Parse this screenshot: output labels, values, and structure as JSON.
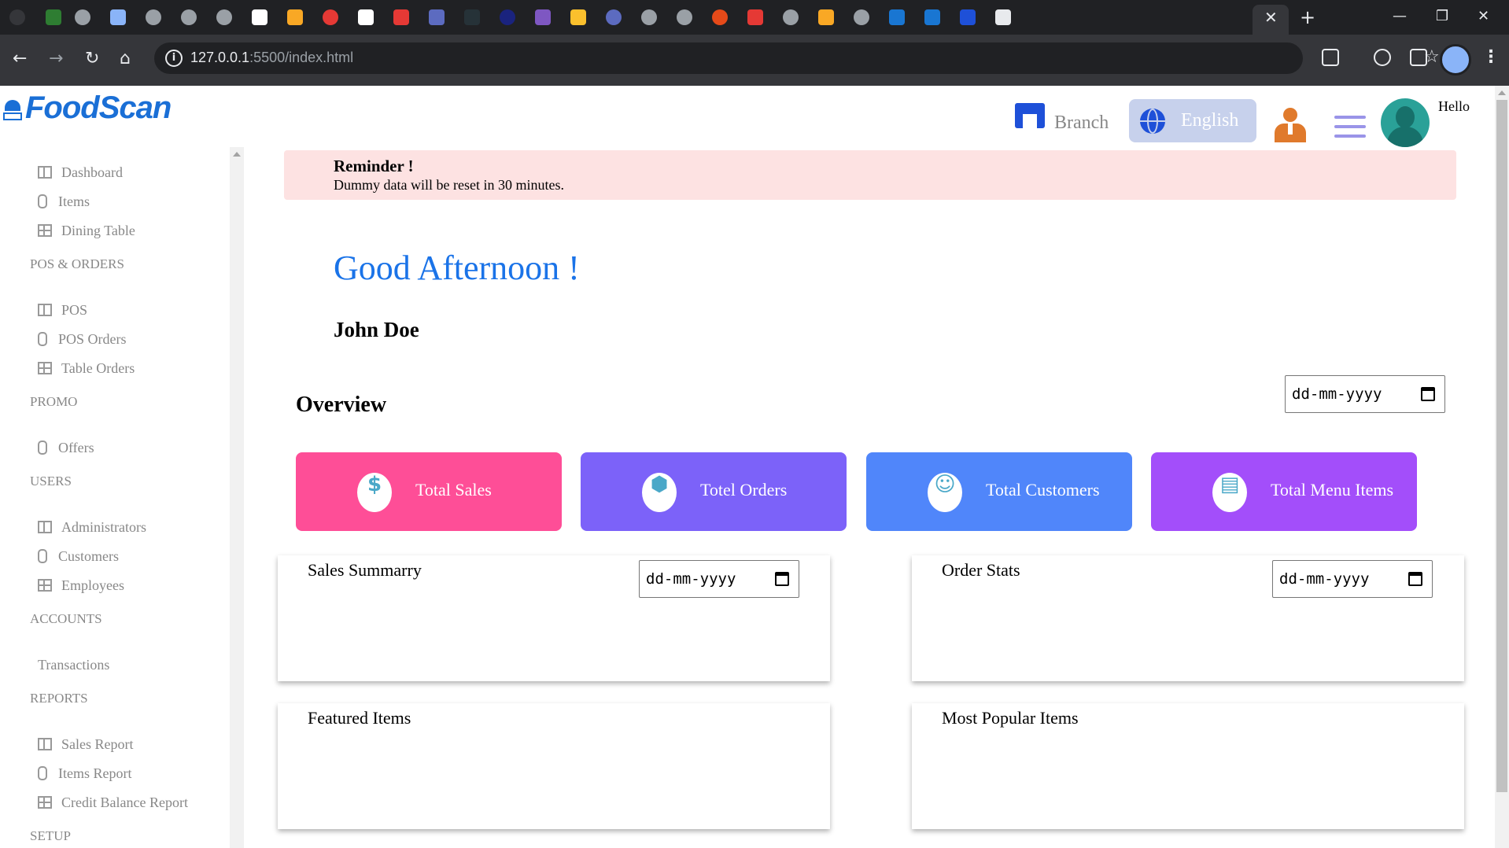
{
  "browser": {
    "tab_close": "✕",
    "new_tab": "+",
    "window_controls": [
      "—",
      "❐",
      "✕"
    ],
    "nav": {
      "back": "←",
      "forward": "→",
      "reload": "↻",
      "home": "⌂"
    },
    "url_host": "127.0.0.1",
    "url_path": ":5500/index.html",
    "bookmark_star": "☆",
    "menu": "⋮"
  },
  "app": {
    "logo_text": "FoodScan",
    "brand_color": "#1a6fd6"
  },
  "header": {
    "branch_label": "Branch",
    "language_label": "English",
    "hello_label": "Hello"
  },
  "sidebar": {
    "groups": [
      {
        "section": "",
        "items": [
          {
            "label": "Dashboard",
            "icon": "grid-icon"
          },
          {
            "label": "Items",
            "icon": "figma-icon"
          },
          {
            "label": "Dining Table",
            "icon": "table-icon"
          }
        ]
      },
      {
        "section": "POS & ORDERS",
        "items": [
          {
            "label": "POS",
            "icon": "grid-icon"
          },
          {
            "label": "POS Orders",
            "icon": "figma-icon"
          },
          {
            "label": "Table Orders",
            "icon": "table-icon"
          }
        ]
      },
      {
        "section": "PROMO",
        "items": [
          {
            "label": "Offers",
            "icon": "figma-icon"
          }
        ]
      },
      {
        "section": "USERS",
        "items": [
          {
            "label": "Administrators",
            "icon": "grid-icon"
          },
          {
            "label": "Customers",
            "icon": "figma-icon"
          },
          {
            "label": "Employees",
            "icon": "table-icon"
          }
        ]
      },
      {
        "section": "ACCOUNTS",
        "items": [
          {
            "label": "Transactions",
            "icon": "none"
          }
        ]
      },
      {
        "section": "REPORTS",
        "items": [
          {
            "label": "Sales Report",
            "icon": "grid-icon"
          },
          {
            "label": "Items Report",
            "icon": "figma-icon"
          },
          {
            "label": "Credit Balance Report",
            "icon": "table-icon"
          }
        ]
      },
      {
        "section": "SETUP",
        "items": []
      }
    ]
  },
  "reminder": {
    "title": "Reminder !",
    "text": "Dummy data will be reset in 30 minutes."
  },
  "main": {
    "greeting": "Good Afternoon !",
    "user_name": "John Doe",
    "overview_title": "Overview",
    "date_placeholder": "dd-mm-yyyy"
  },
  "stats": [
    {
      "label": "Total Sales",
      "icon": "dollar-icon",
      "glyph": "$",
      "color": "#fe4e97",
      "icon_color": "#4aa8c8"
    },
    {
      "label": "Totel Orders",
      "icon": "box-icon",
      "glyph": "⬢",
      "color": "#7c62f9",
      "icon_color": "#4aa8c8"
    },
    {
      "label": "Total Customers",
      "icon": "user-icon",
      "glyph": "☺",
      "color": "#5086fa",
      "icon_color": "#4aa8c8"
    },
    {
      "label": "Total Menu Items",
      "icon": "document-icon",
      "glyph": "▤",
      "color": "#a34efa",
      "icon_color": "#4aa8c8"
    }
  ],
  "panels": {
    "sales_summary": {
      "title": "Sales Summarry",
      "date_placeholder": "dd-mm-yyyy"
    },
    "order_stats": {
      "title": "Order Stats",
      "date_placeholder": "dd-mm-yyyy"
    },
    "featured_items": {
      "title": "Featured Items"
    },
    "most_popular_items": {
      "title": "Most Popular Items"
    }
  }
}
